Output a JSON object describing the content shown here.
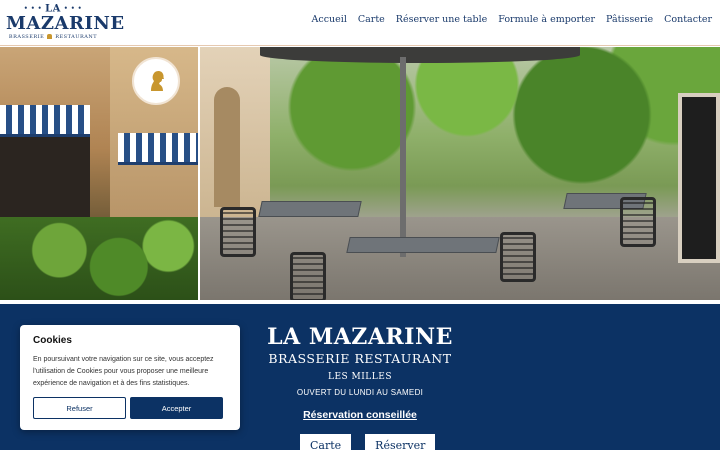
{
  "header": {
    "logo": {
      "top": "LA",
      "main": "MAZARINE",
      "sub_left": "BRASSERIE",
      "sub_right": "RESTAURANT"
    },
    "nav": [
      "Accueil",
      "Carte",
      "Réserver une table",
      "Formule à emporter",
      "Pâtisserie",
      "Contacter"
    ]
  },
  "hero": {
    "images": [
      "brasserie-facade-photo",
      "terrace-photo"
    ],
    "medallion_icon": "woman-profile-icon"
  },
  "band": {
    "title": "LA MAZARINE",
    "subtitle": "BRASSERIE RESTAURANT",
    "location": "LES MILLES",
    "hours": "OUVERT DU LUNDI AU SAMEDI",
    "reservation_link": "Réservation conseillée",
    "buttons": {
      "menu": "Carte",
      "reserve": "Réserver"
    }
  },
  "cookie_banner": {
    "title": "Cookies",
    "text": "En poursuivant votre navigation sur ce site, vous acceptez l'utilisation de Cookies pour vous proposer une meilleure expérience de navigation et à des fins statistiques.",
    "refuse_label": "Refuser",
    "accept_label": "Accepter"
  },
  "colors": {
    "brand_blue": "#0c3264",
    "logo_blue": "#1a3a6b",
    "gold": "#c8962e"
  }
}
